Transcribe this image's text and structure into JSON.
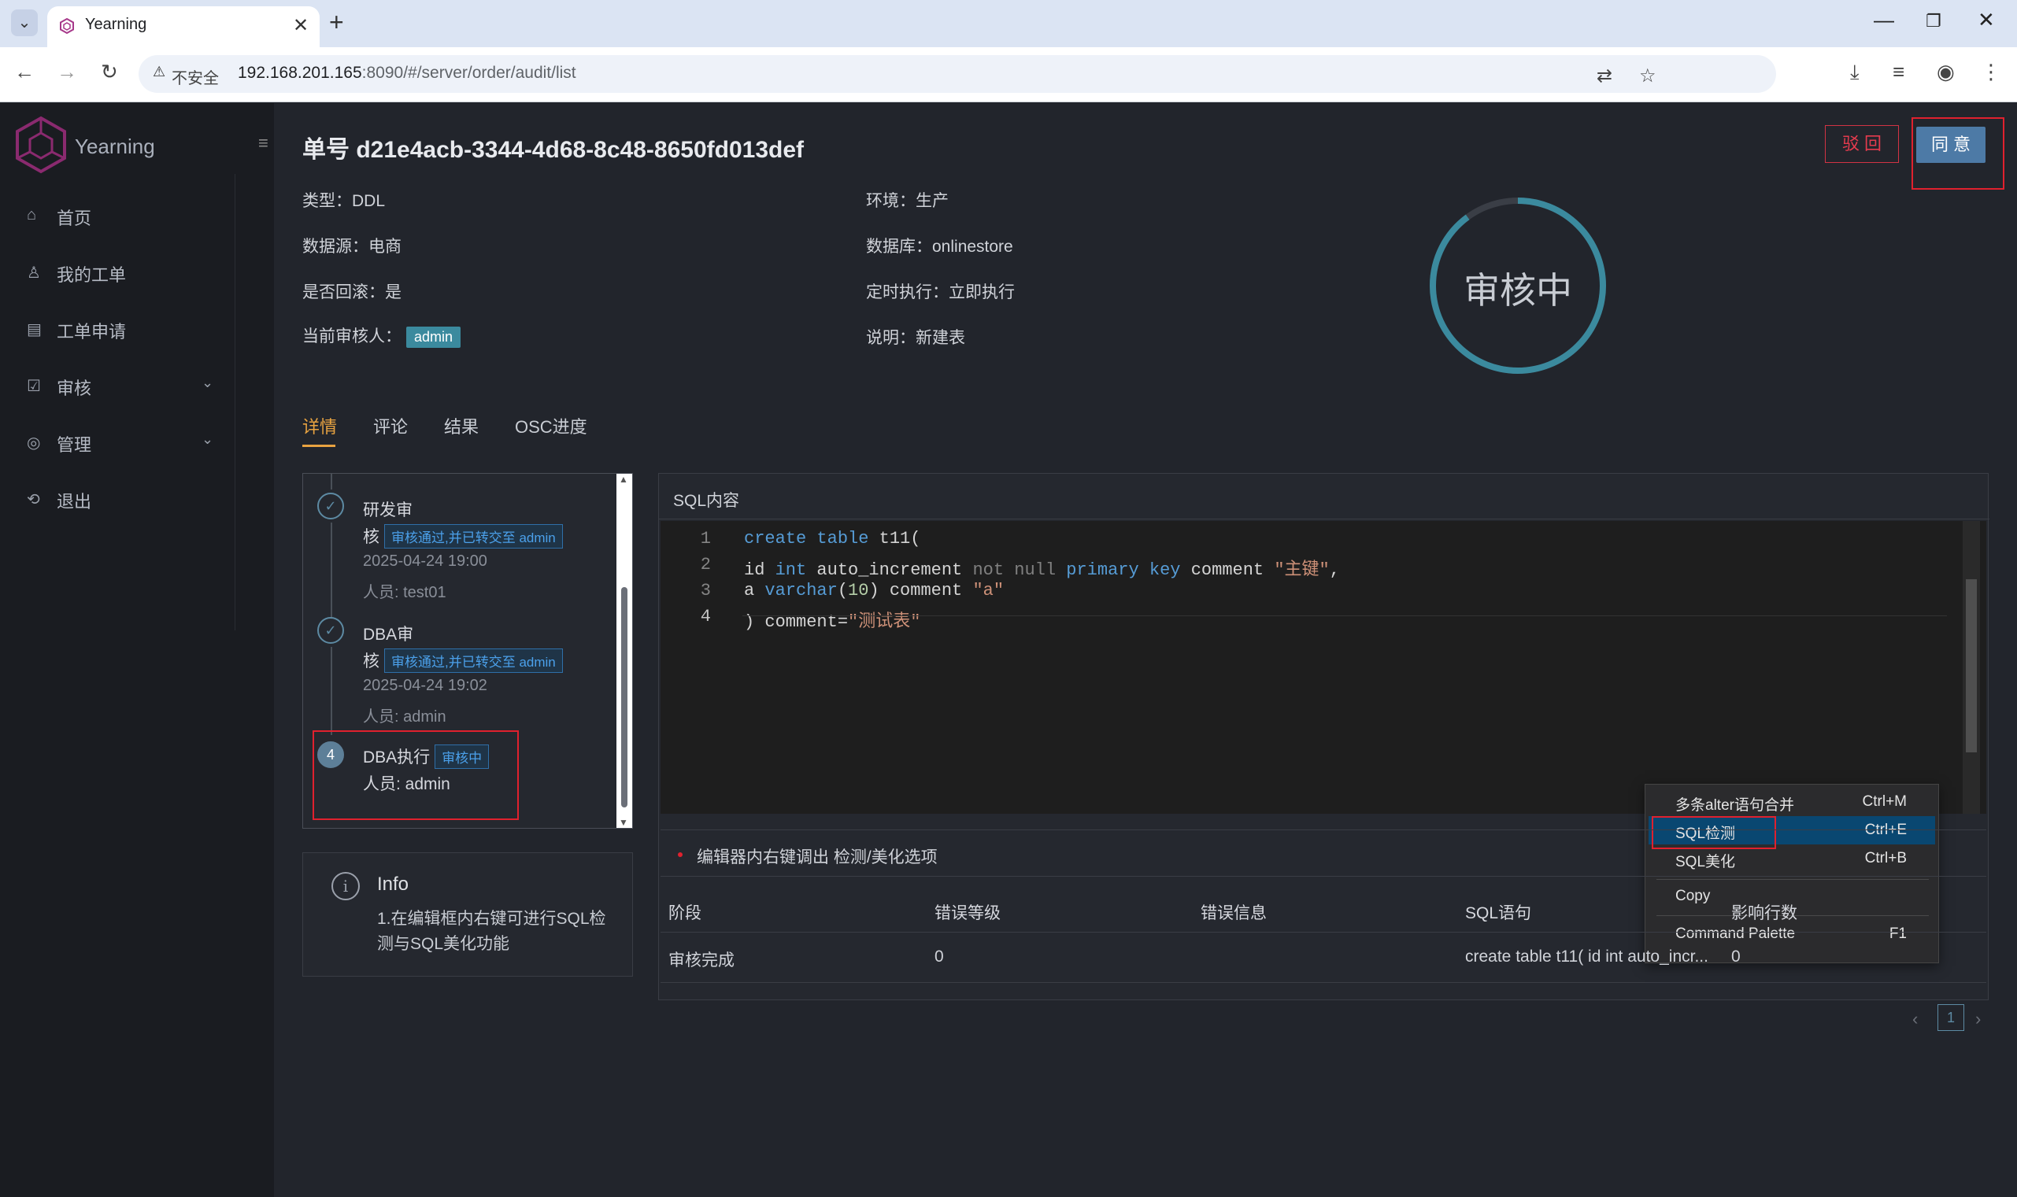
{
  "browser": {
    "tab_title": "Yearning",
    "security_label": "不安全",
    "url_host": "192.168.201.165",
    "url_rest": ":8090/#/server/order/audit/list"
  },
  "sidebar": {
    "logo_text": "Yearning",
    "items": [
      {
        "label": "首页",
        "icon": "home-icon"
      },
      {
        "label": "我的工单",
        "icon": "user-icon"
      },
      {
        "label": "工单申请",
        "icon": "form-icon"
      },
      {
        "label": "审核",
        "icon": "audit-icon"
      },
      {
        "label": "管理",
        "icon": "settings-icon"
      },
      {
        "label": "退出",
        "icon": "logout-icon"
      }
    ]
  },
  "order": {
    "title": "单号 d21e4acb-3344-4d68-8c48-8650fd013def",
    "type": "类型：DDL",
    "source": "数据源：电商",
    "rollback": "是否回滚：是",
    "reviewer_label": "当前审核人：",
    "reviewer": "admin",
    "env": "环境：生产",
    "database": "数据库：onlinestore",
    "schedule": "定时执行：立即执行",
    "desc": "说明：新建表",
    "status": "审核中",
    "reject_label": "驳 回",
    "approve_label": "同 意"
  },
  "tabs": [
    "详情",
    "评论",
    "结果",
    "OSC进度"
  ],
  "timeline": [
    {
      "name_1": "研发审",
      "name_2": "核",
      "tag": "审核通过,并已转交至 admin",
      "time": "2025-04-24 19:00",
      "person": "人员: test01"
    },
    {
      "name_1": "DBA审",
      "name_2": "核",
      "tag": "审核通过,并已转交至 admin",
      "time": "2025-04-24 19:02",
      "person": "人员: admin"
    },
    {
      "index": "4",
      "name_1": "DBA执行",
      "tag": "审核中",
      "person": "人员: admin"
    }
  ],
  "info_card": {
    "title": "Info",
    "text": "1.在编辑框内右键可进行SQL检测与SQL美化功能"
  },
  "sql_panel": {
    "header": "SQL内容",
    "line_numbers": [
      "1",
      "2",
      "3",
      "4"
    ],
    "hint": "编辑器内右键调出 检测/美化选项"
  },
  "context_menu": [
    {
      "label": "多条alter语句合并",
      "shortcut": "Ctrl+M"
    },
    {
      "label": "SQL检测",
      "shortcut": "Ctrl+E"
    },
    {
      "label": "SQL美化",
      "shortcut": "Ctrl+B"
    },
    {
      "label": "Copy",
      "shortcut": ""
    },
    {
      "label": "Command Palette",
      "shortcut": "F1"
    }
  ],
  "result_table": {
    "headers": [
      "阶段",
      "错误等级",
      "错误信息",
      "SQL语句",
      "影响行数"
    ],
    "rows": [
      {
        "stage": "审核完成",
        "level": "0",
        "message": "",
        "sql": "create table t11( id int auto_incr...",
        "rows": "0"
      }
    ],
    "page": "1"
  },
  "colors": {
    "accent": "#e8a341",
    "ring": "#3b8a9e",
    "approve": "#4d7aa6",
    "reject": "#e53b4e",
    "highlight_box": "#e0212e"
  }
}
